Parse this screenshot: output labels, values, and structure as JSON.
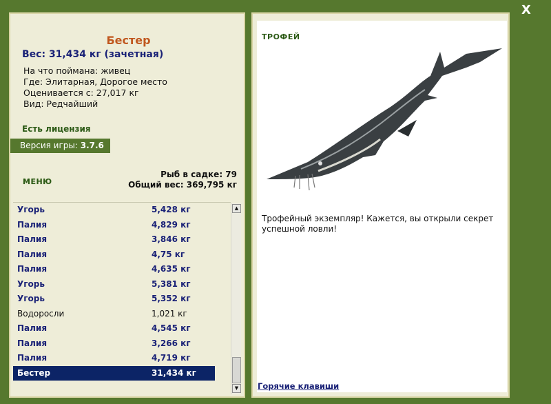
{
  "close_label": "X",
  "left": {
    "fish_name": "Бестер",
    "weight_line": "Вес: 31,434 кг (зачетная)",
    "info": [
      "На что поймана: живец",
      "Где: Элитарная, Дорогое место",
      "Оценивается с: 27,017 кг",
      "Вид: Редчайший"
    ],
    "license": "Есть лицензия",
    "version_label": "Версия игры:",
    "version_value": "3.7.6",
    "menu_label": "МЕНЮ",
    "totals": {
      "count_line": "Рыб в садке: 79",
      "weight_line": "Общий вес: 369,795 кг"
    },
    "catch": [
      {
        "name": "Угорь",
        "weight": "5,428 кг",
        "style": "bold"
      },
      {
        "name": "Палия",
        "weight": "4,829 кг",
        "style": "bold"
      },
      {
        "name": "Палия",
        "weight": "3,846 кг",
        "style": "bold"
      },
      {
        "name": "Палия",
        "weight": "4,75 кг",
        "style": "bold"
      },
      {
        "name": "Палия",
        "weight": "4,635 кг",
        "style": "bold"
      },
      {
        "name": "Угорь",
        "weight": "5,381 кг",
        "style": "bold"
      },
      {
        "name": "Угорь",
        "weight": "5,352 кг",
        "style": "bold"
      },
      {
        "name": "Водоросли",
        "weight": "1,021 кг",
        "style": "plain"
      },
      {
        "name": "Палия",
        "weight": "4,545 кг",
        "style": "bold"
      },
      {
        "name": "Палия",
        "weight": "3,266 кг",
        "style": "bold"
      },
      {
        "name": "Палия",
        "weight": "4,719 кг",
        "style": "bold"
      },
      {
        "name": "Бестер",
        "weight": "31,434 кг",
        "style": "selected"
      }
    ]
  },
  "right": {
    "trophy_label": "ТРОФЕЙ",
    "trophy_text": "Трофейный экземпляр! Кажется, вы открыли секрет успешной ловли!",
    "hotkeys_label": "Горячие клавиши"
  },
  "colors": {
    "frame": "#56782e",
    "panel": "#eeedd8",
    "accent_name": "#c0571e",
    "accent_blue": "#1a2277",
    "selected_row": "#0c2466"
  },
  "icons": [
    "close-icon",
    "scroll-up-icon",
    "scroll-down-icon"
  ]
}
